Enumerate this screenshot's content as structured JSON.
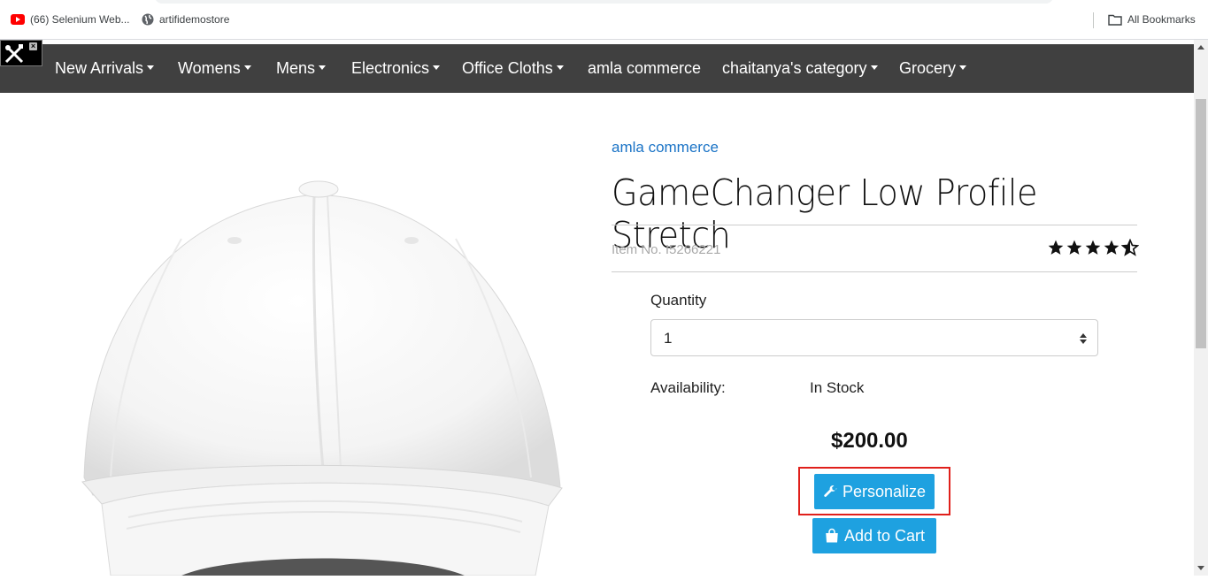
{
  "bookmarks": {
    "items": [
      {
        "label": "(66) Selenium Web...",
        "icon": "youtube-icon"
      },
      {
        "label": "artifidemostore",
        "icon": "globe-icon"
      }
    ],
    "all_bookmarks": "All Bookmarks"
  },
  "nav": {
    "items": [
      {
        "label": "New Arrivals",
        "dropdown": true
      },
      {
        "label": "Womens",
        "dropdown": true
      },
      {
        "label": "Mens",
        "dropdown": true
      },
      {
        "label": "Electronics",
        "dropdown": true
      },
      {
        "label": "Office Cloths",
        "dropdown": true
      },
      {
        "label": "amla commerce",
        "dropdown": false
      },
      {
        "label": "chaitanya's category",
        "dropdown": true
      },
      {
        "label": "Grocery",
        "dropdown": true
      }
    ]
  },
  "product": {
    "brand": "amla commerce",
    "title": "GameChanger Low Profile Stretch",
    "item_no": "Item No. I5266221",
    "rating": 4.5,
    "quantity_label": "Quantity",
    "quantity_value": "1",
    "availability_label": "Availability:",
    "availability_value": "In Stock",
    "price": "$200.00",
    "personalize_label": "Personalize",
    "add_to_cart_label": "Add to Cart"
  },
  "colors": {
    "nav_bg": "#404040",
    "button_bg": "#1ea1e0",
    "brand_link": "#1a73c6",
    "highlight_box": "#e0201b"
  }
}
